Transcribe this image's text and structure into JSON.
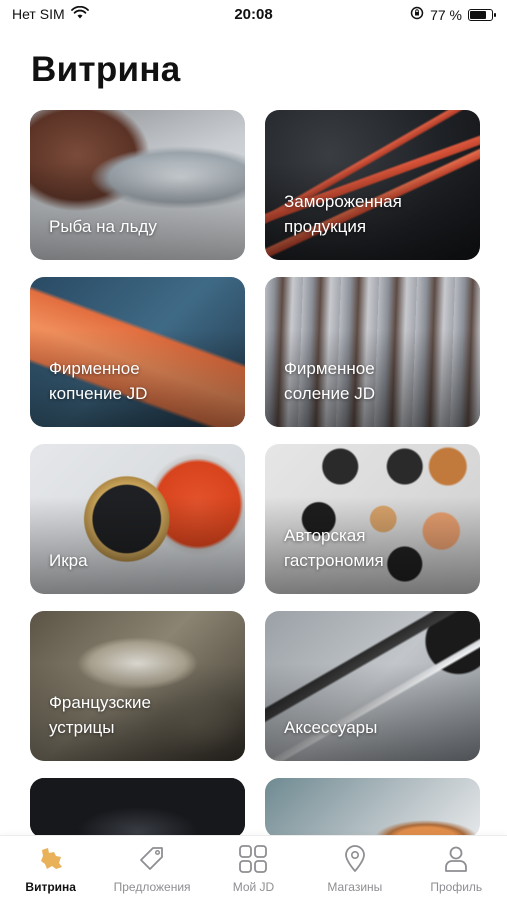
{
  "status_bar": {
    "carrier": "Нет SIM",
    "time": "20:08",
    "battery_percent": "77 %",
    "battery_level": 0.77
  },
  "page_title": "Витрина",
  "tiles": [
    {
      "label": "Рыба на льду",
      "image": "fish-on-ice"
    },
    {
      "label": "Замороженная\nпродукция",
      "image": "frozen-crab"
    },
    {
      "label": "Фирменное\nкопчение JD",
      "image": "smoked-salmon"
    },
    {
      "label": "Фирменное\nсоление JD",
      "image": "salted-herring"
    },
    {
      "label": "Икра",
      "image": "caviar-jar"
    },
    {
      "label": "Авторская\nгастрономия",
      "image": "gastronomy-jars"
    },
    {
      "label": "Французские\nустрицы",
      "image": "oysters"
    },
    {
      "label": "Аксессуары",
      "image": "oyster-knife"
    },
    {
      "label": "",
      "image": "dark-product"
    },
    {
      "label": "",
      "image": "food-bowl"
    }
  ],
  "tab_bar": {
    "active_color": "#e8b15a",
    "items": [
      {
        "label": "Витрина",
        "icon": "map-icon",
        "active": true
      },
      {
        "label": "Предложения",
        "icon": "tag-icon",
        "active": false
      },
      {
        "label": "Мой JD",
        "icon": "grid-icon",
        "active": false
      },
      {
        "label": "Магазины",
        "icon": "location-pin-icon",
        "active": false
      },
      {
        "label": "Профиль",
        "icon": "person-icon",
        "active": false
      }
    ]
  }
}
